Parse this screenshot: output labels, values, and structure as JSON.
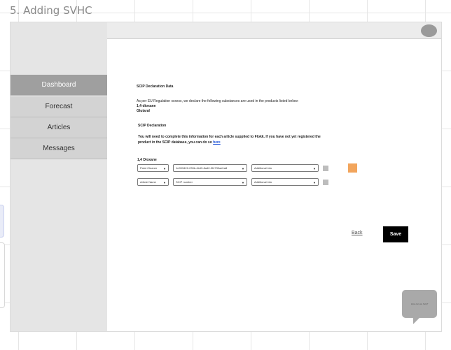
{
  "frame_title": "5. Adding SVHC",
  "nav": [
    {
      "label": "Dashboard",
      "active": true
    },
    {
      "label": "Forecast",
      "active": false
    },
    {
      "label": "Articles",
      "active": false
    },
    {
      "label": "Messages",
      "active": false
    }
  ],
  "content": {
    "heading": "SCIP Declaration Data",
    "intro": "As per EU Regulation xxxxxx, we declare the following substances are used in the products listed below:",
    "substances": [
      "1,4-dioxane",
      "Glutaral"
    ],
    "section_title": "SCIP Declaration",
    "notice_line1": "You will need to complete this information for each article supplied to Flokk. If you have not yet registered the",
    "notice_line2_prefix": "product in the SCIP database, you can do so",
    "notice_link": "here",
    "group_label": "1,4 Dioxane",
    "rows": [
      {
        "select1": "Paint Cleaner",
        "select2": "1e993422-239b-4b49-8a42-3f4730ad1a8",
        "select3": "Additional info"
      },
      {
        "select1": "Article Name",
        "select2": "SCIP number",
        "select3": "Additional info"
      }
    ],
    "back_label": "Back",
    "save_label": "Save"
  },
  "chat": {
    "text": "How can we help?"
  },
  "colors": {
    "accent_orange": "#f2a55c",
    "nav_active": "#9f9f9f",
    "save_button": "#000000"
  }
}
